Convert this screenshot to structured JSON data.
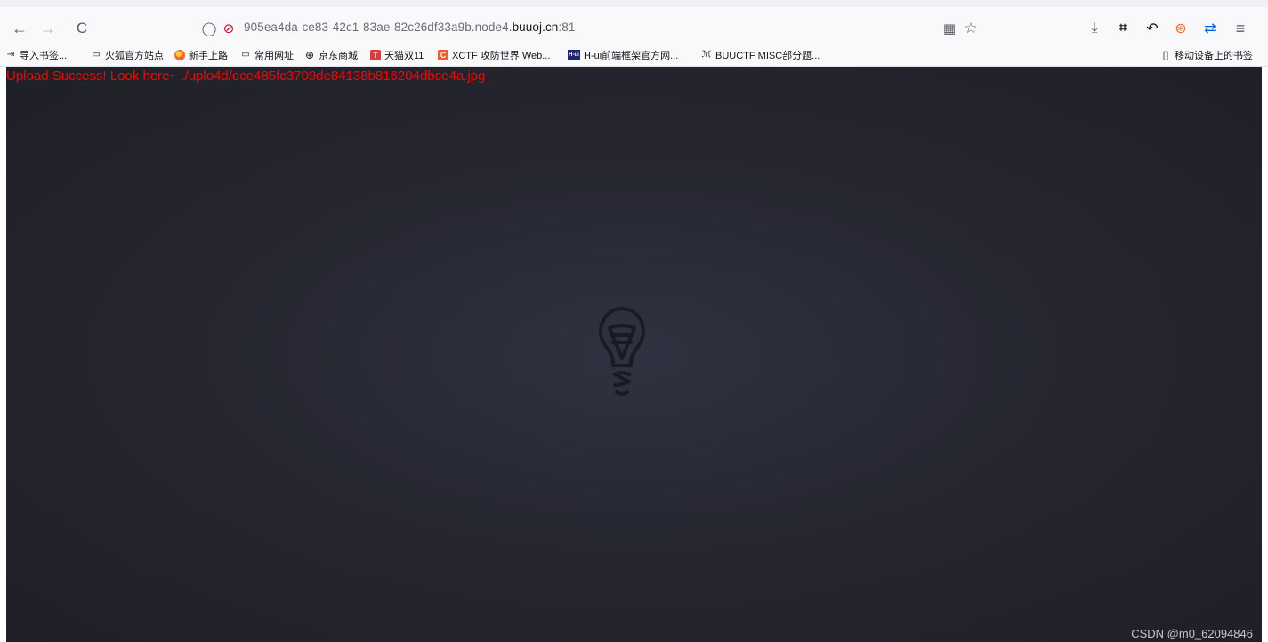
{
  "browser": {
    "url": {
      "prefix": "905ea4da-ce83-42c1-83ae-82c26df33a9b.node4.",
      "domain": "buuoj.cn",
      "suffix": ":81"
    },
    "icons": {
      "back": "←",
      "forward": "→",
      "reload": "C",
      "shield": "◯",
      "lock_warning": "⊘",
      "qr": "▦",
      "star": "☆",
      "download": "⤓",
      "crop": "⌗",
      "undo": "↶",
      "extension": "⊛",
      "sync": "⇄",
      "menu": "≡"
    }
  },
  "bookmarks": [
    {
      "label": "导入书签...",
      "icon": "⇥"
    },
    {
      "label": "火狐官方站点",
      "icon": "▭"
    },
    {
      "label": "新手上路",
      "icon": ""
    },
    {
      "label": "常用网址",
      "icon": "▭"
    },
    {
      "label": "京东商城",
      "icon": "⊕"
    },
    {
      "label": "天猫双11",
      "icon": "T"
    },
    {
      "label": "XCTF 攻防世界 Web...",
      "icon": "C"
    },
    {
      "label": "H-ui前端框架官方网...",
      "icon": "H-ui"
    },
    {
      "label": "BUUCTF MISC部分题...",
      "icon": "ℳ"
    }
  ],
  "mobile_bookmarks": {
    "label": "移动设备上的书签",
    "icon": "▯"
  },
  "page": {
    "message": "Upload Success! Look here~ ./uplo4d/ece485fc3709de84138b816204dbce4a.jpg",
    "watermark": "CSDN @m0_62094846"
  },
  "colors": {
    "message": "#ff0000",
    "background": "#262731"
  }
}
